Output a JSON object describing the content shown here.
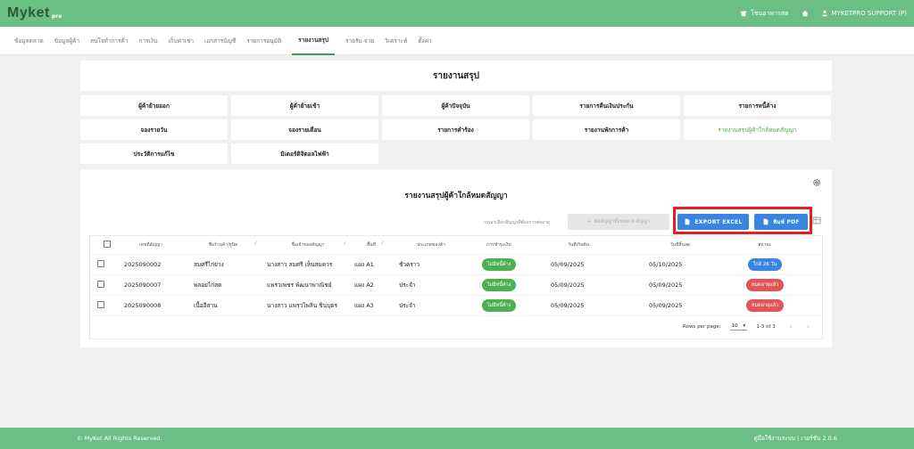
{
  "topbar": {
    "logo": "Myket",
    "logo_sub": "pro",
    "store_label": "โชนอาหารสด",
    "user_label": "MYKETPRO SUPPORT (P)"
  },
  "nav": [
    "ข้อมูลตลาด",
    "ข้อมูลผู้ค้า",
    "สนใจทำการค้า",
    "การเงิน",
    "เก็บค่าเช่า",
    "เอกสารบัญชี",
    "รายการอนุมัติ",
    "รายงานสรุป",
    "รายรับ-จ่าย",
    "วิเคราะห์",
    "ตั้งค่า"
  ],
  "page_title": "รายงานสรุป",
  "tiles": [
    "ผู้ค้าย้ายออก",
    "ผู้ค้าย้ายเข้า",
    "ผู้ค้าปัจจุบัน",
    "รายการคืนเงินประกัน",
    "รายการหนี้ค้าง",
    "จองรายวัน",
    "จองรายเดือน",
    "รายการคำร้อง",
    "รายงานพักการค้า",
    "รายงานสรุปผู้ค้าใกล้หมดสัญญา",
    "ประวัติการแก้ไข",
    "มิเตอร์ดิจิตอลไฟฟ้า"
  ],
  "report": {
    "title": "รายงานสรุปผู้ค้าใกล้หมดสัญญา",
    "hint": "กรุณาเลือกสัญญาที่ต้องการต่ออายุ",
    "renew_all": "ต่อสัญญาทั้งหมด 0 สัญญา",
    "export_excel": "EXPORT EXCEL",
    "print_pdf": "พิมพ์ PDF",
    "columns": [
      "เลขที่สัญญา",
      "ชื่อร้านค้า/ยูนิต",
      "ชื่อเจ้าของสัญญา",
      "พื้นที่",
      "ประเภทของค้า",
      "การชำระเงิน",
      "วันที่เริ่มต้น",
      "วันที่สิ้นสุด",
      "สถานะ"
    ],
    "rows": [
      {
        "contract": "2025090002",
        "shop": "สมศรีไก่ย่าง",
        "owner": "นางสาว สมศรี เห็นสมควร",
        "area": "แผง A1",
        "type": "ชั่วคราว",
        "payment": "ไม่มีหนี้ค้าง",
        "start": "05/09/2025",
        "end": "05/10/2025",
        "status": "ใกล้ 26 วัน",
        "status_color": "#3a85e0"
      },
      {
        "contract": "2025090007",
        "shop": "พลอยไก่สด",
        "owner": "แพรวเพชร พัฒนาพาณิชย์",
        "area": "แผง A2",
        "type": "ประจำ",
        "payment": "ไม่มีหนี้ค้าง",
        "start": "05/09/2025",
        "end": "05/09/2025",
        "status": "หมดอายุแล้ว",
        "status_color": "#e05555"
      },
      {
        "contract": "2025090008",
        "shop": "เนื้ออีสาน",
        "owner": "นางสาว แพรวไพลิน ชินบุตร",
        "area": "แผง A3",
        "type": "ประจำ",
        "payment": "ไม่มีหนี้ค้าง",
        "start": "05/09/2025",
        "end": "05/09/2025",
        "status": "หมดอายุแล้ว",
        "status_color": "#e05555"
      }
    ],
    "rows_per_page_label": "Rows per page:",
    "rows_per_page": "10",
    "range": "1-3 of 3"
  },
  "footer": {
    "copyright": "© MyKet All Rights Reserved.",
    "manual": "คู่มือใช้งานระบบ | เวอร์ชั่น 2.0.6"
  }
}
